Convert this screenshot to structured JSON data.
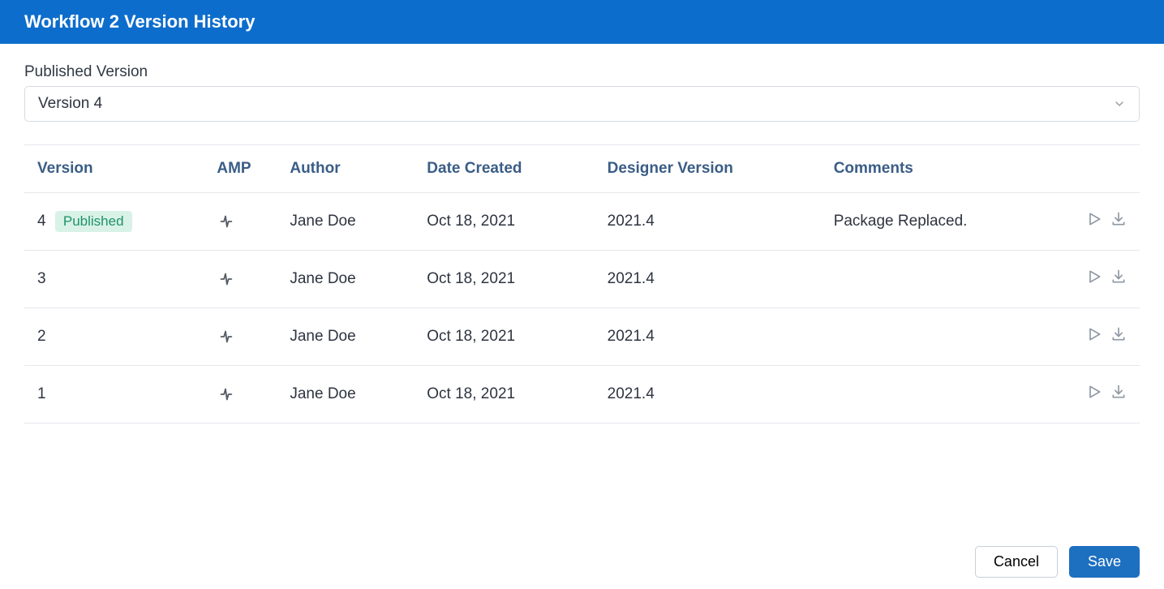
{
  "header": {
    "title": "Workflow 2 Version History"
  },
  "published_version_label": "Published Version",
  "published_version_value": "Version 4",
  "badge_label": "Published",
  "columns": {
    "version": "Version",
    "amp": "AMP",
    "author": "Author",
    "date": "Date Created",
    "designer": "Designer Version",
    "comments": "Comments"
  },
  "rows": [
    {
      "version": "4",
      "published": true,
      "author": "Jane Doe",
      "date": "Oct 18, 2021",
      "designer": "2021.4",
      "comments": "Package Replaced."
    },
    {
      "version": "3",
      "published": false,
      "author": "Jane Doe",
      "date": "Oct 18, 2021",
      "designer": "2021.4",
      "comments": ""
    },
    {
      "version": "2",
      "published": false,
      "author": "Jane Doe",
      "date": "Oct 18, 2021",
      "designer": "2021.4",
      "comments": ""
    },
    {
      "version": "1",
      "published": false,
      "author": "Jane Doe",
      "date": "Oct 18, 2021",
      "designer": "2021.4",
      "comments": ""
    }
  ],
  "footer": {
    "cancel": "Cancel",
    "save": "Save"
  }
}
